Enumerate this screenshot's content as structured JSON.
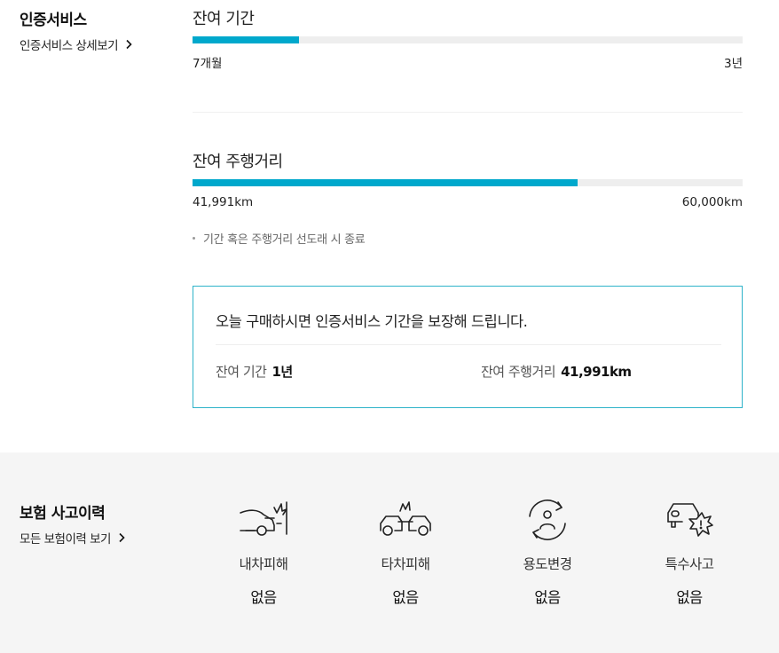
{
  "certification": {
    "title": "인증서비스",
    "detail_link": "인증서비스 상세보기"
  },
  "remaining_period": {
    "title": "잔여 기간",
    "progress": 0.194,
    "start_label": "7개월",
    "end_label": "3년"
  },
  "remaining_mileage": {
    "title": "잔여 주행거리",
    "progress": 0.6999,
    "start_label": "41,991km",
    "end_label": "60,000km"
  },
  "note": "기간 혹은 주행거리 선도래 시 종료",
  "promo": {
    "title": "오늘 구매하시면 인증서비스 기간을 보장해 드립니다.",
    "period_label": "잔여 기간",
    "period_value": "1년",
    "mileage_label": "잔여 주행거리",
    "mileage_value": "41,991km"
  },
  "insurance": {
    "title": "보험 사고이력",
    "all_link": "모든 보험이력 보기",
    "items": [
      {
        "icon": "own-car-damage-icon",
        "label": "내차피해",
        "value": "없음"
      },
      {
        "icon": "other-car-damage-icon",
        "label": "타차피해",
        "value": "없음"
      },
      {
        "icon": "usage-change-icon",
        "label": "용도변경",
        "value": "없음"
      },
      {
        "icon": "special-accident-icon",
        "label": "특수사고",
        "value": "없음"
      }
    ]
  },
  "colors": {
    "accent": "#00a8cc",
    "promo_border": "#2eb3c9",
    "track": "#eeeeee",
    "bottom_bg": "#f5f5f5"
  }
}
